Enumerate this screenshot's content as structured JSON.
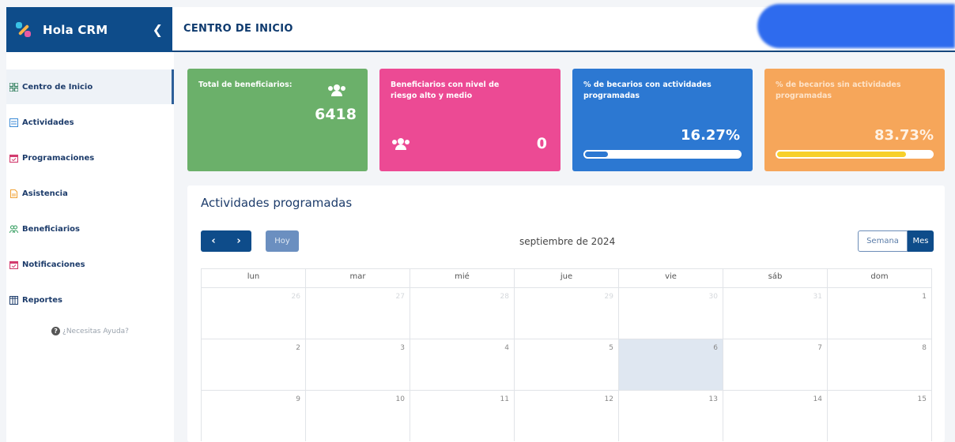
{
  "brand": {
    "name": "Hola CRM",
    "collapse_icon": "chevron-left-icon"
  },
  "header": {
    "title": "CENTRO DE INICIO"
  },
  "sidebar": {
    "items": [
      {
        "label": "Centro de Inicio",
        "icon": "dashboard-grid-icon",
        "active": true
      },
      {
        "label": "Actividades",
        "icon": "list-icon"
      },
      {
        "label": "Programaciones",
        "icon": "calendar-icon"
      },
      {
        "label": "Asistencia",
        "icon": "document-icon"
      },
      {
        "label": "Beneficiarios",
        "icon": "users-icon"
      },
      {
        "label": "Notificaciones",
        "icon": "calendar-icon"
      },
      {
        "label": "Reportes",
        "icon": "table-icon"
      }
    ],
    "help": "¿Necesitas Ayuda?"
  },
  "cards": {
    "total": {
      "label": "Total de beneficiarios:",
      "value": "6418",
      "color": "#6bb06a"
    },
    "risk": {
      "label": "Beneficiarios con nivel de riesgo alto y medio",
      "value": "0",
      "color": "#ec4a94"
    },
    "scheduled": {
      "label": "% de becarios con actividades programadas",
      "value": "16.27%",
      "progress": 0.1627,
      "color": "#2c78d2"
    },
    "unscheduled": {
      "label": "% de becarios sin actividades programadas",
      "value": "83.73%",
      "progress": 0.8373,
      "color": "#f6a65a"
    }
  },
  "calendar": {
    "title": "Actividades programadas",
    "prev": "‹",
    "next": "›",
    "today": "Hoy",
    "month": "septiembre de 2024",
    "views": {
      "week": "Semana",
      "month": "Mes"
    },
    "weekdays": [
      "lun",
      "mar",
      "mié",
      "jue",
      "vie",
      "sáb",
      "dom"
    ],
    "weeks": [
      [
        "26",
        "27",
        "28",
        "29",
        "30",
        "31",
        "1"
      ],
      [
        "2",
        "3",
        "4",
        "5",
        "6",
        "7",
        "8"
      ],
      [
        "9",
        "10",
        "11",
        "12",
        "13",
        "14",
        "15"
      ]
    ],
    "today_date": "6"
  }
}
